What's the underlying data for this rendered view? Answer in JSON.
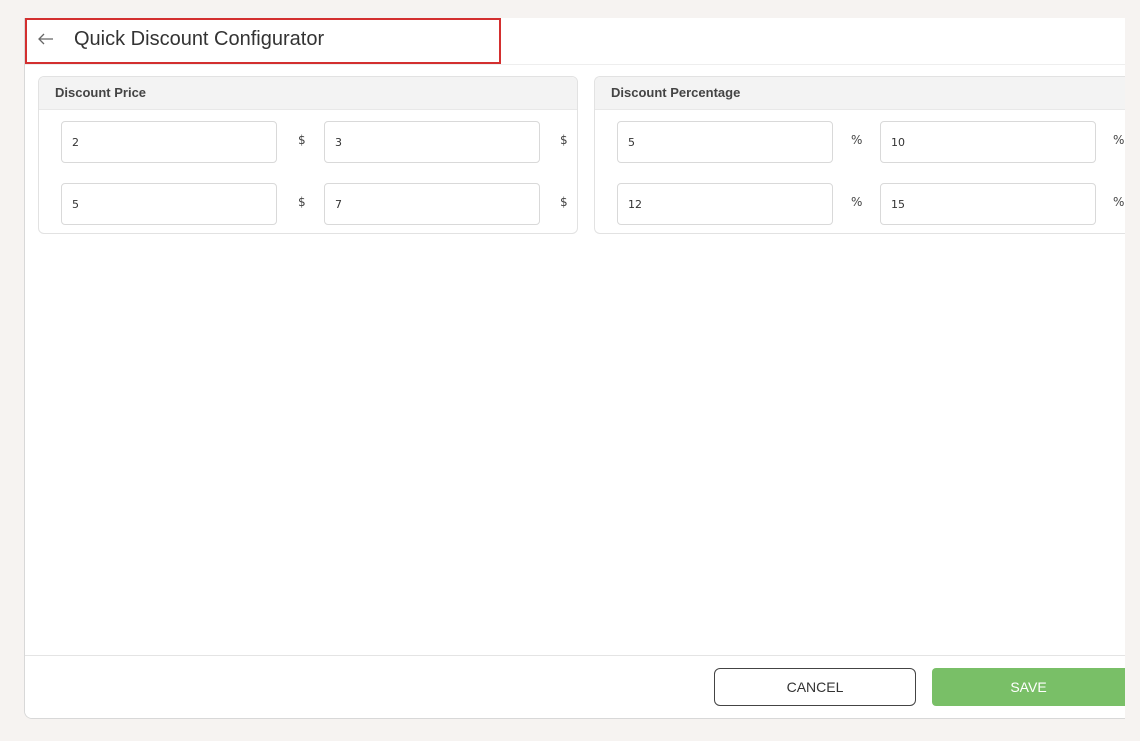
{
  "header": {
    "back_icon": "arrow-left-icon",
    "title": "Quick Discount Configurator"
  },
  "discount_price": {
    "title": "Discount Price",
    "unit": "$",
    "values": [
      "2",
      "3",
      "5",
      "7"
    ]
  },
  "discount_percentage": {
    "title": "Discount Percentage",
    "unit": "%",
    "values": [
      "5",
      "10",
      "12",
      "15"
    ]
  },
  "footer": {
    "cancel_label": "CANCEL",
    "save_label": "SAVE"
  },
  "colors": {
    "highlight": "#d32f2f",
    "save_button": "#79bf67"
  }
}
